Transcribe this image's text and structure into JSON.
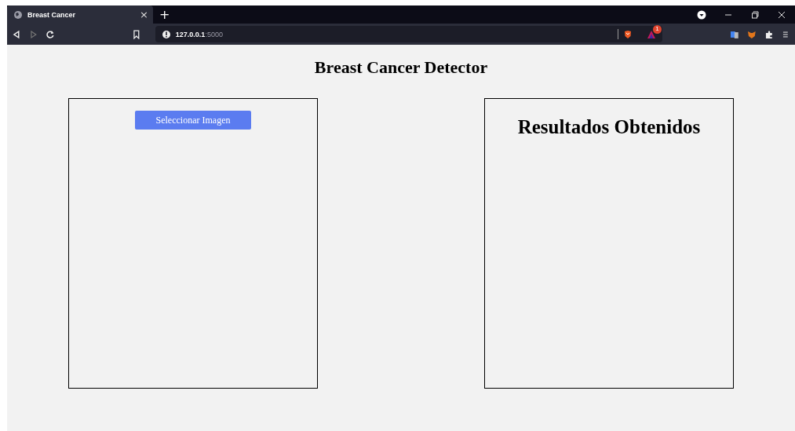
{
  "browser": {
    "tab": {
      "title": "Breast Cancer",
      "close": "×"
    },
    "new_tab": "+",
    "address": {
      "host": "127.0.0.1",
      "port": ":5000"
    },
    "rewards_badge": "1"
  },
  "page": {
    "title": "Breast Cancer Detector",
    "left_panel": {
      "button": "Seleccionar Imagen"
    },
    "right_panel": {
      "heading": "Resultados Obtenidos"
    }
  }
}
